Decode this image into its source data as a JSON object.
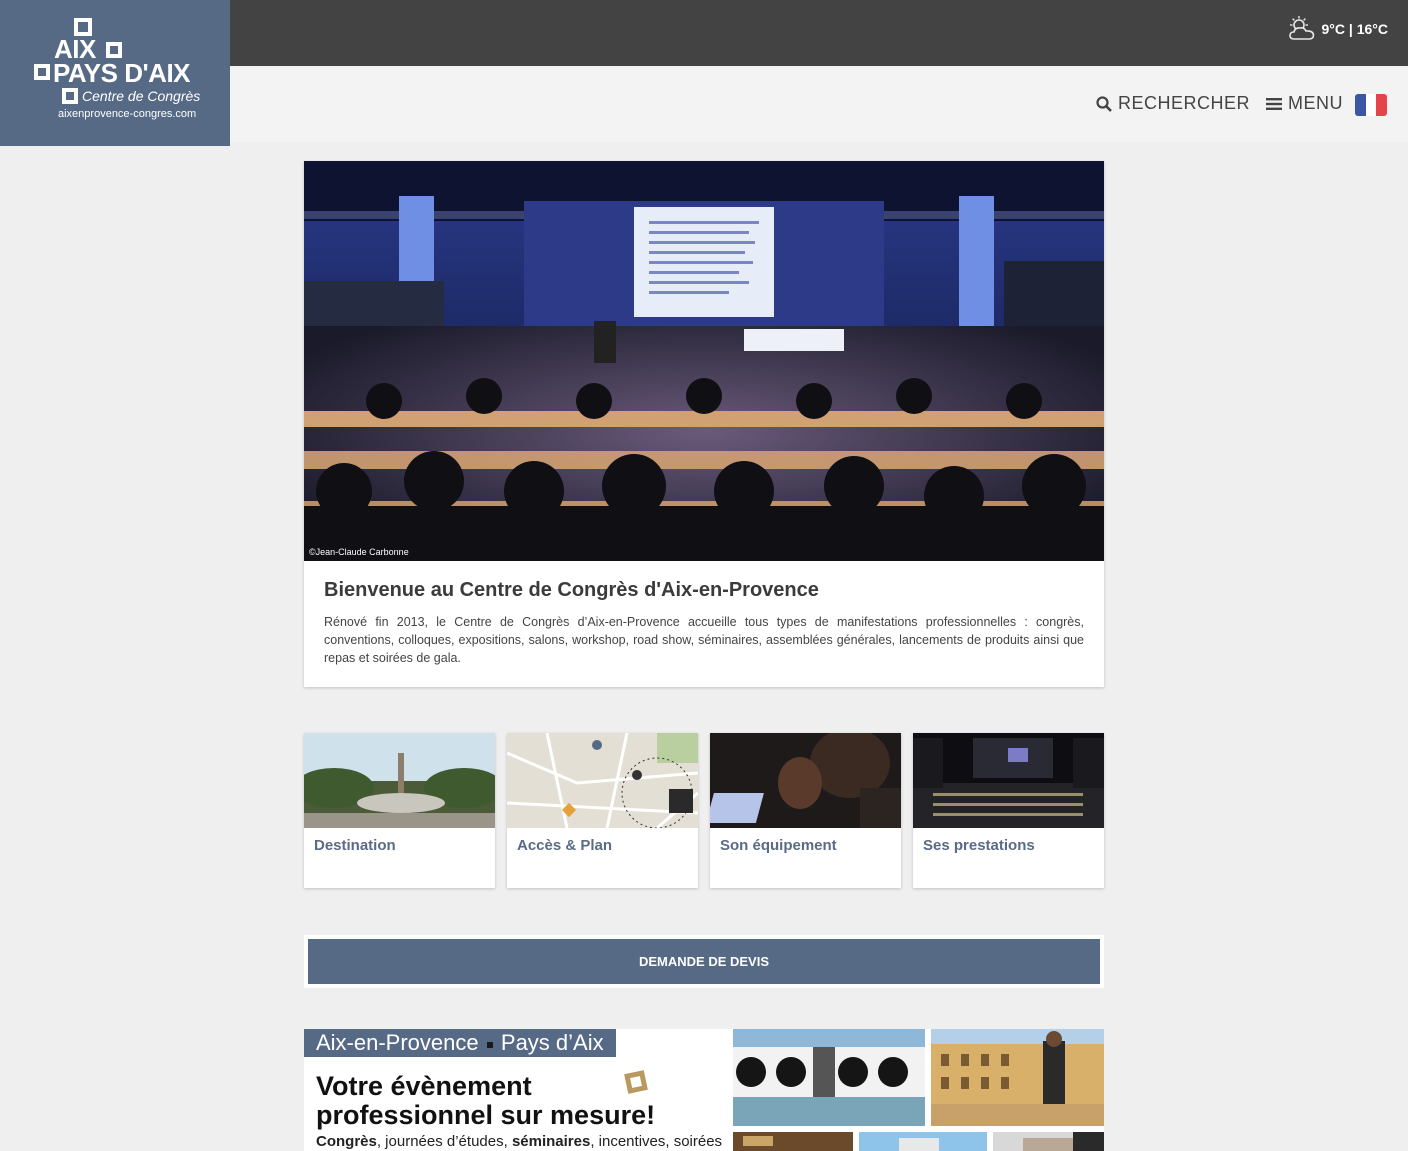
{
  "logo": {
    "line1": "AIX",
    "line2": "PAYS D'AIX",
    "line3": "Centre de Congrès",
    "url": "aixenprovence-congres.com"
  },
  "weather": {
    "icon": "partly-cloudy-icon",
    "temps": "9°C | 16°C"
  },
  "nav": {
    "search_label": "RECHERCHER",
    "menu_label": "MENU",
    "language_flag": "fr-flag-icon"
  },
  "welcome": {
    "photo_credit": "©Jean-Claude Carbonne",
    "title": "Bienvenue au Centre de Congrès d'Aix-en-Provence",
    "text": "Rénové fin 2013, le Centre de Congrès d’Aix-en-Provence accueille tous types de manifestations professionnelles : congrès, conventions, colloques, expositions, salons, workshop, road show, séminaires, assemblées générales, lancements de produits ainsi que repas et soirées de gala."
  },
  "cards": [
    {
      "label": "Destination"
    },
    {
      "label": "Accès & Plan"
    },
    {
      "label": "Son équipement"
    },
    {
      "label": "Ses prestations"
    }
  ],
  "devis": {
    "label": "DEMANDE DE DEVIS"
  },
  "promo": {
    "tag_part1": "Aix-en-Provence",
    "tag_part2": "Pays d’Aix",
    "title": "Votre évènement professionnel sur mesure!",
    "sub_b1": "Congrès",
    "sub_t1": ", journées d’études, ",
    "sub_b2": "séminaires",
    "sub_t2": ", incentives, soirées"
  },
  "colors": {
    "brand_blue": "#566a86",
    "topbar": "#434343",
    "background": "#efefef",
    "accent_gold": "#b89a61"
  }
}
